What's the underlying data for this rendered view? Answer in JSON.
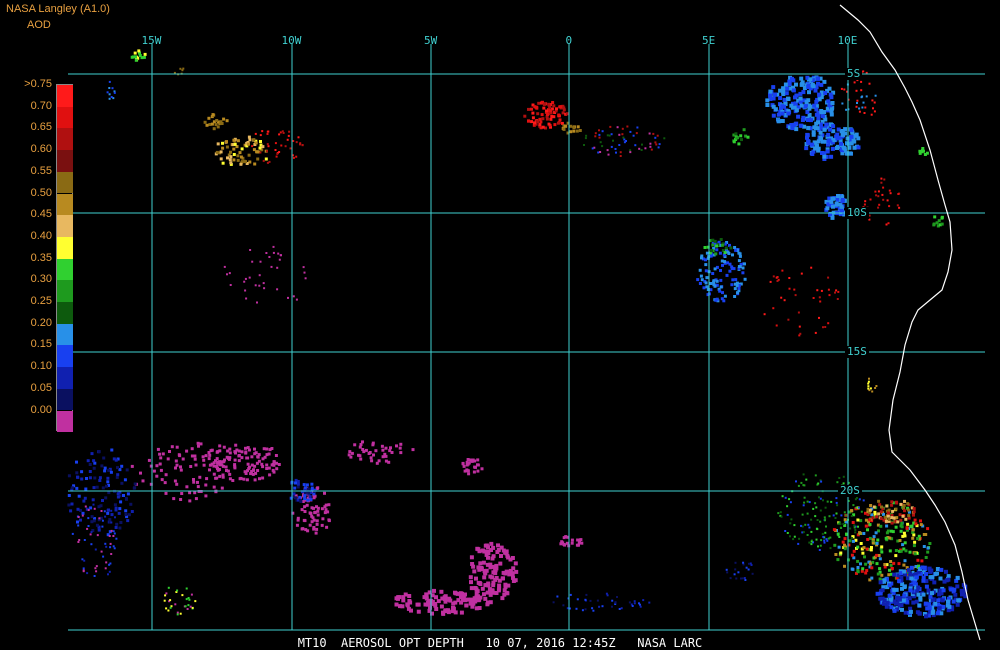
{
  "header": {
    "title": "NASA Langley (A1.0)",
    "variable": "AOD"
  },
  "colors": {
    "grid": "#40d0d0",
    "header_text": "#e8a040",
    "footer_text": "#ffffff",
    "coastline": "#ffffff",
    "background": "#000000"
  },
  "color_scale": [
    {
      "label": ">0.75",
      "color": "#ff1a1a"
    },
    {
      "label": "0.70",
      "color": "#e01010"
    },
    {
      "label": "0.65",
      "color": "#b01010"
    },
    {
      "label": "0.60",
      "color": "#7a1010"
    },
    {
      "label": "0.55",
      "color": "#8a6a14"
    },
    {
      "label": "0.50",
      "color": "#b88a20"
    },
    {
      "label": "0.45",
      "color": "#e8b860"
    },
    {
      "label": "0.40",
      "color": "#ffff30"
    },
    {
      "label": "0.35",
      "color": "#30d030"
    },
    {
      "label": "0.30",
      "color": "#1e9a1e"
    },
    {
      "label": "0.25",
      "color": "#0d5a0d"
    },
    {
      "label": "0.20",
      "color": "#2890e8"
    },
    {
      "label": "0.15",
      "color": "#1840f0"
    },
    {
      "label": "0.10",
      "color": "#1020b0"
    },
    {
      "label": "0.05",
      "color": "#0a1060"
    },
    {
      "label": "0.00",
      "color": "#c030a0"
    }
  ],
  "longitude_labels": [
    {
      "label": "15W"
    },
    {
      "label": "10W"
    },
    {
      "label": "5W"
    },
    {
      "label": "0"
    },
    {
      "label": "5E"
    },
    {
      "label": "10E"
    }
  ],
  "latitude_labels": [
    {
      "label": "5S"
    },
    {
      "label": "10S"
    },
    {
      "label": "15S"
    },
    {
      "label": "20S"
    }
  ],
  "footer": "MT10  AEROSOL OPT DEPTH   10 07, 2016 12:45Z   NASA LARC"
}
